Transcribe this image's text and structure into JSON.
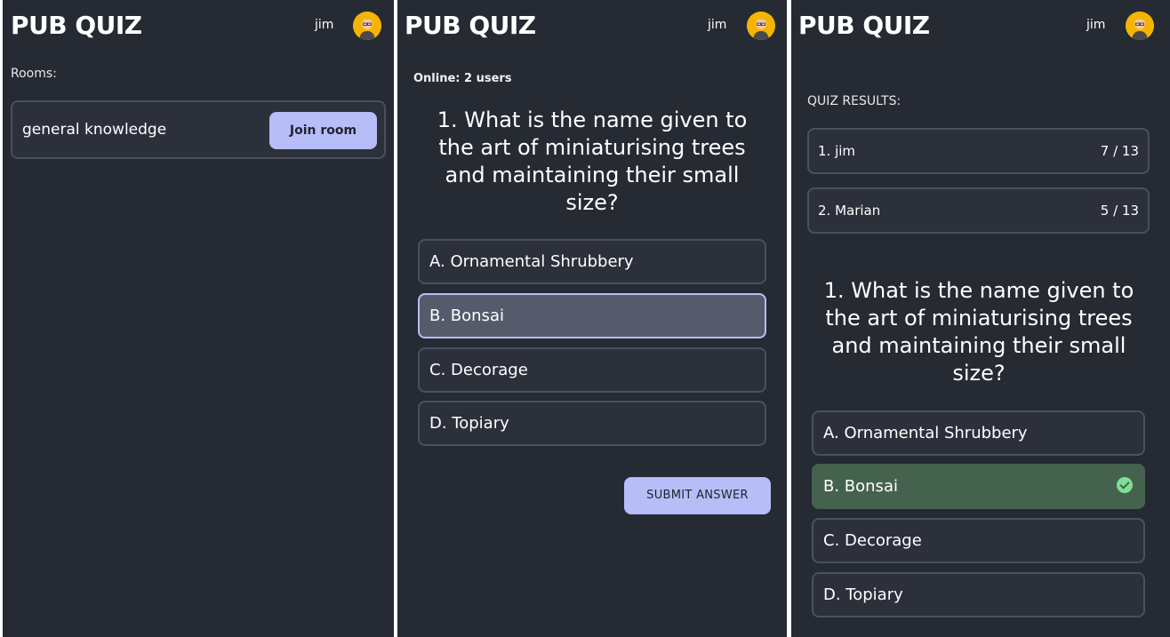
{
  "app": {
    "title": "PUB QUIZ",
    "username": "jim"
  },
  "lobby": {
    "rooms_label": "Rooms:",
    "rooms": [
      {
        "name": "general knowledge",
        "action_label": "Join room"
      }
    ]
  },
  "question_screen": {
    "online_text": "Online: 2 users",
    "question": "1. What is the name given to the art of miniaturising trees and maintaining their small size?",
    "options": [
      {
        "label": "A. Ornamental Shrubbery",
        "state": "default"
      },
      {
        "label": "B. Bonsai",
        "state": "selected"
      },
      {
        "label": "C. Decorage",
        "state": "default"
      },
      {
        "label": "D. Topiary",
        "state": "default"
      }
    ],
    "submit_label": "SUBMIT ANSWER"
  },
  "results_screen": {
    "results_label": "QUIZ RESULTS:",
    "results": [
      {
        "name": "1. jim",
        "score": "7 / 13"
      },
      {
        "name": "2. Marian",
        "score": "5 / 13"
      }
    ],
    "question": "1. What is the name given to the art of miniaturising trees and maintaining their small size?",
    "options": [
      {
        "label": "A. Ornamental Shrubbery",
        "state": "default"
      },
      {
        "label": "B. Bonsai",
        "state": "correct",
        "icon": "check-circle-icon"
      },
      {
        "label": "C. Decorage",
        "state": "default"
      },
      {
        "label": "D. Topiary",
        "state": "default"
      }
    ]
  },
  "colors": {
    "background": "#252a33",
    "accent": "#b7bdf7",
    "correct": "#45624e",
    "avatar": "#f4b400"
  }
}
